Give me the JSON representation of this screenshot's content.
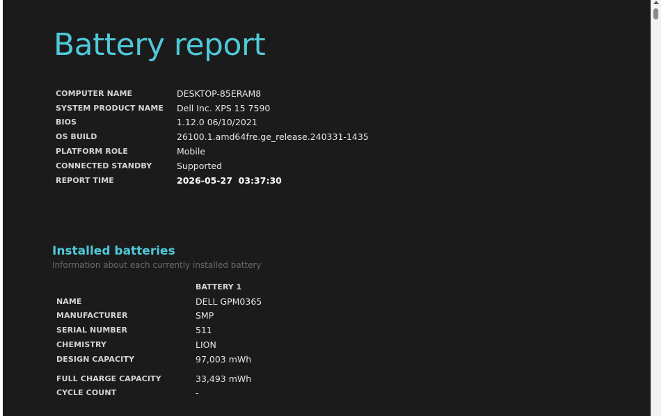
{
  "report": {
    "title": "Battery report",
    "system_info": [
      {
        "label": "COMPUTER NAME",
        "value": "DESKTOP-85ERAM8"
      },
      {
        "label": "SYSTEM PRODUCT NAME",
        "value": "Dell Inc. XPS 15 7590"
      },
      {
        "label": "BIOS",
        "value": "1.12.0 06/10/2021"
      },
      {
        "label": "OS BUILD",
        "value": "26100.1.amd64fre.ge_release.240331-1435"
      },
      {
        "label": "PLATFORM ROLE",
        "value": "Mobile"
      },
      {
        "label": "CONNECTED STANDBY",
        "value": "Supported"
      },
      {
        "label": "REPORT TIME",
        "value": "2026-05-27  03:37:30"
      }
    ]
  },
  "installed_batteries": {
    "title": "Installed batteries",
    "subtitle": "Information about each currently installed battery",
    "column_header": "BATTERY 1",
    "rows": [
      {
        "label": "NAME",
        "value": "DELL GPM0365"
      },
      {
        "label": "MANUFACTURER",
        "value": "SMP"
      },
      {
        "label": "SERIAL NUMBER",
        "value": "511"
      },
      {
        "label": "CHEMISTRY",
        "value": "LION"
      },
      {
        "label": "DESIGN CAPACITY",
        "value": "97,003 mWh"
      },
      {
        "label": "FULL CHARGE CAPACITY",
        "value": "33,493 mWh"
      },
      {
        "label": "CYCLE COUNT",
        "value": "-"
      }
    ]
  },
  "colors": {
    "background": "#1b1b1b",
    "accent": "#4fc9d8",
    "subtitle": "#6a6a6a"
  },
  "scrollbar": {
    "up_icon": "chevron-up-icon"
  }
}
